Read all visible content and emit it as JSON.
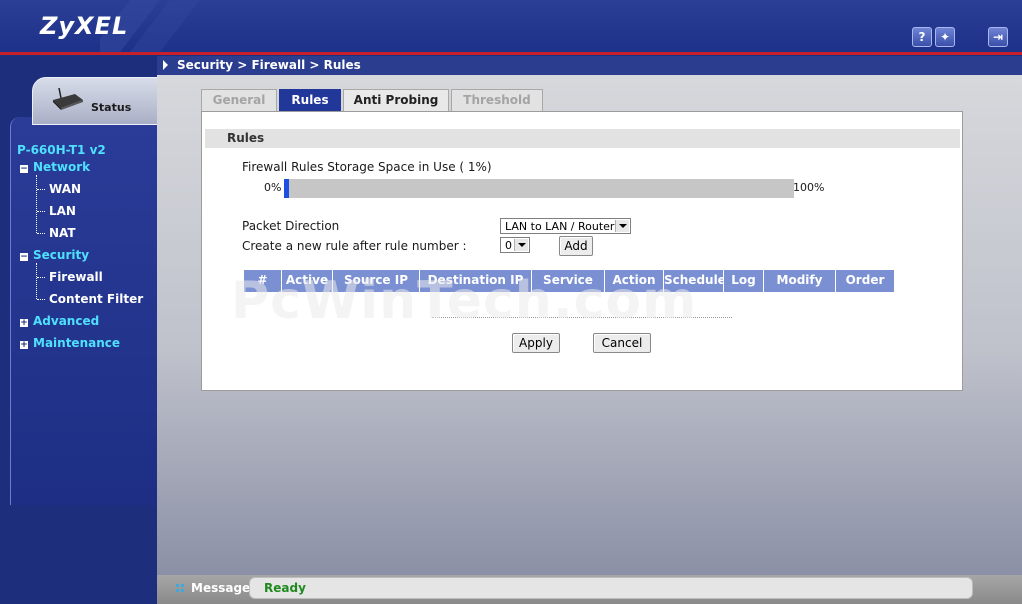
{
  "header": {
    "logo": "ZyXEL",
    "help_label": "?",
    "wizard_label": "✦",
    "logout_label": "⇥"
  },
  "breadcrumb": "Security > Firewall > Rules",
  "sidebar": {
    "status_label": "Status",
    "device": "P-660H-T1 v2",
    "groups": [
      {
        "label": "Network",
        "toggle": "−",
        "items": [
          "WAN",
          "LAN",
          "NAT"
        ]
      },
      {
        "label": "Security",
        "toggle": "−",
        "items": [
          "Firewall",
          "Content Filter"
        ]
      },
      {
        "label": "Advanced",
        "toggle": "+"
      },
      {
        "label": "Maintenance",
        "toggle": "+"
      }
    ]
  },
  "tabs": [
    {
      "label": "General",
      "state": "disabled"
    },
    {
      "label": "Rules",
      "state": "active"
    },
    {
      "label": "Anti Probing",
      "state": "normal"
    },
    {
      "label": "Threshold",
      "state": "disabled"
    }
  ],
  "panel": {
    "title": "Rules",
    "storage_label": "Firewall Rules Storage Space in Use  ( 1%)",
    "storage_percent": 1,
    "progress_min": "0%",
    "progress_max": "100%",
    "packet_direction_label": "Packet Direction",
    "packet_direction_value": "LAN to LAN / Router",
    "new_rule_label": "Create a new rule after rule number :",
    "new_rule_value": "0",
    "add_label": "Add",
    "table_headers": [
      "#",
      "Active",
      "Source IP",
      "Destination IP",
      "Service",
      "Action",
      "Schedule",
      "Log",
      "Modify",
      "Order"
    ],
    "apply_label": "Apply",
    "cancel_label": "Cancel"
  },
  "watermark": "PcWinTech.com",
  "message": {
    "label": "Message",
    "text": "Ready"
  },
  "colors": {
    "header_bg": "#2b3f96",
    "accent_red": "#c8202a",
    "nav_text": "#4fe0ff",
    "table_header": "#7b90d2",
    "active_tab": "#22379a",
    "ready_text": "#1f8a1f"
  }
}
